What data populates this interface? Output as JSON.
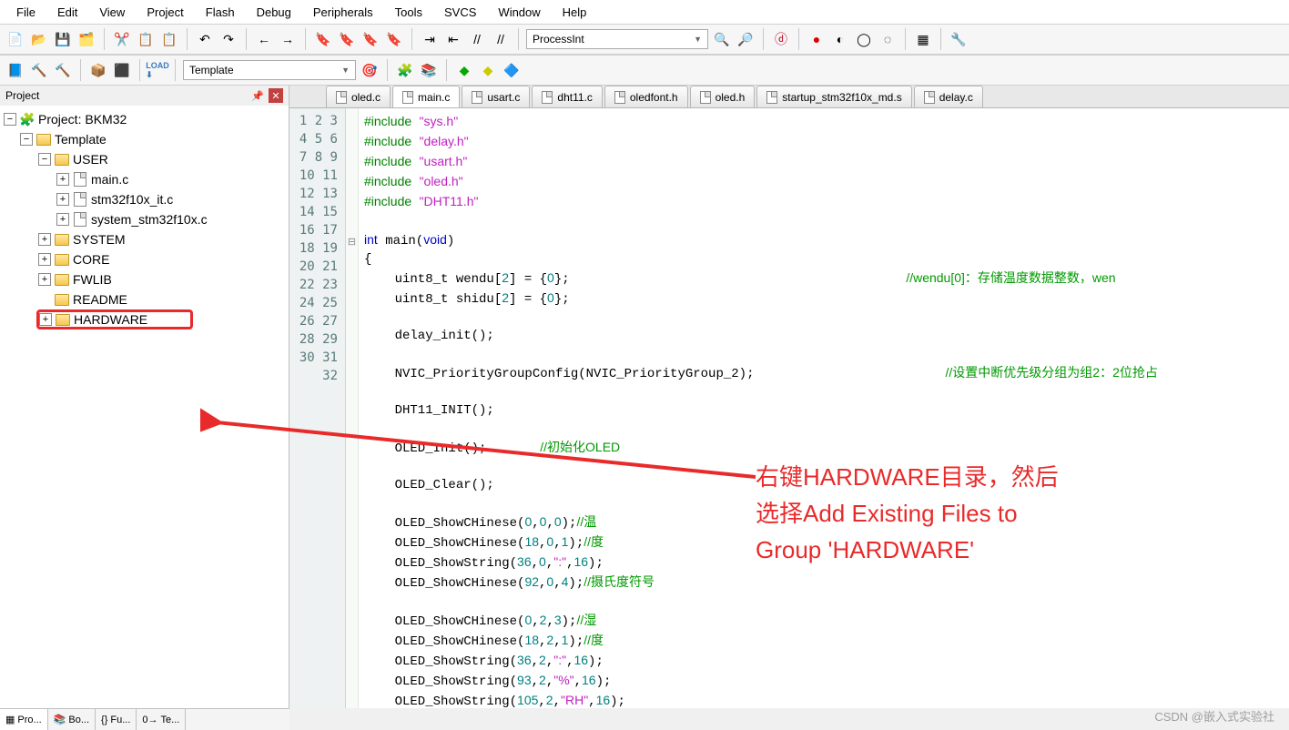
{
  "menu": [
    "File",
    "Edit",
    "View",
    "Project",
    "Flash",
    "Debug",
    "Peripherals",
    "Tools",
    "SVCS",
    "Window",
    "Help"
  ],
  "toolbar2": {
    "template_label": "Template"
  },
  "target_name": "ProcessInt",
  "project_panel": {
    "title": "Project",
    "root": "Project: BKM32",
    "target": "Template",
    "groups": {
      "user": "USER",
      "user_files": [
        "main.c",
        "stm32f10x_it.c",
        "system_stm32f10x.c"
      ],
      "system": "SYSTEM",
      "core": "CORE",
      "fwlib": "FWLIB",
      "readme": "README",
      "hardware": "HARDWARE"
    },
    "tabs": [
      "Pro...",
      "Bo...",
      "Fu...",
      "Te..."
    ]
  },
  "file_tabs": [
    "oled.c",
    "main.c",
    "usart.c",
    "dht11.c",
    "oledfont.h",
    "oled.h",
    "startup_stm32f10x_md.s",
    "delay.c"
  ],
  "active_tab": 1,
  "code_lines": [
    {
      "n": 1,
      "html": "<span class='inc'>#include</span> <span class='str'>\"sys.h\"</span>"
    },
    {
      "n": 2,
      "html": "<span class='inc'>#include</span> <span class='str'>\"delay.h\"</span>"
    },
    {
      "n": 3,
      "html": "<span class='inc'>#include</span> <span class='str'>\"usart.h\"</span>"
    },
    {
      "n": 4,
      "html": "<span class='inc'>#include</span> <span class='str'>\"oled.h\"</span>"
    },
    {
      "n": 5,
      "html": "<span class='inc'>#include</span> <span class='str'>\"DHT11.h\"</span>"
    },
    {
      "n": 6,
      "html": ""
    },
    {
      "n": 7,
      "html": "<span class='kw'>int</span> main(<span class='kw'>void</span>)"
    },
    {
      "n": 8,
      "html": "{",
      "fold": "-"
    },
    {
      "n": 9,
      "html": "    uint8_t wendu[<span class='num'>2</span>] = {<span class='num'>0</span>};                                            <span class='cmt'>//wendu[0]：存储温度数据整数，wen</span>"
    },
    {
      "n": 10,
      "html": "    uint8_t shidu[<span class='num'>2</span>] = {<span class='num'>0</span>};"
    },
    {
      "n": 11,
      "html": ""
    },
    {
      "n": 12,
      "html": "    delay_init();"
    },
    {
      "n": 13,
      "html": ""
    },
    {
      "n": 14,
      "html": "    NVIC_PriorityGroupConfig(NVIC_PriorityGroup_2);                         <span class='cmt'>//设置中断优先级分组为组2：2位抢占</span>"
    },
    {
      "n": 15,
      "html": ""
    },
    {
      "n": 16,
      "html": "    DHT11_INIT();"
    },
    {
      "n": 17,
      "html": ""
    },
    {
      "n": 18,
      "html": "    OLED_Init();       <span class='cmt'>//初始化OLED</span>"
    },
    {
      "n": 19,
      "html": ""
    },
    {
      "n": 20,
      "html": "    OLED_Clear();"
    },
    {
      "n": 21,
      "html": ""
    },
    {
      "n": 22,
      "html": "    OLED_ShowCHinese(<span class='num'>0</span>,<span class='num'>0</span>,<span class='num'>0</span>);<span class='cmt'>//温</span>"
    },
    {
      "n": 23,
      "html": "    OLED_ShowCHinese(<span class='num'>18</span>,<span class='num'>0</span>,<span class='num'>1</span>);<span class='cmt'>//度</span>"
    },
    {
      "n": 24,
      "html": "    OLED_ShowString(<span class='num'>36</span>,<span class='num'>0</span>,<span class='str'>\":\"</span>,<span class='num'>16</span>);"
    },
    {
      "n": 25,
      "html": "    OLED_ShowCHinese(<span class='num'>92</span>,<span class='num'>0</span>,<span class='num'>4</span>);<span class='cmt'>//摄氏度符号</span>"
    },
    {
      "n": 26,
      "html": ""
    },
    {
      "n": 27,
      "html": "    OLED_ShowCHinese(<span class='num'>0</span>,<span class='num'>2</span>,<span class='num'>3</span>);<span class='cmt'>//湿</span>"
    },
    {
      "n": 28,
      "html": "    OLED_ShowCHinese(<span class='num'>18</span>,<span class='num'>2</span>,<span class='num'>1</span>);<span class='cmt'>//度</span>"
    },
    {
      "n": 29,
      "html": "    OLED_ShowString(<span class='num'>36</span>,<span class='num'>2</span>,<span class='str'>\":\"</span>,<span class='num'>16</span>);"
    },
    {
      "n": 30,
      "html": "    OLED_ShowString(<span class='num'>93</span>,<span class='num'>2</span>,<span class='str'>\"%\"</span>,<span class='num'>16</span>);"
    },
    {
      "n": 31,
      "html": "    OLED_ShowString(<span class='num'>105</span>,<span class='num'>2</span>,<span class='str'>\"RH\"</span>,<span class='num'>16</span>);"
    },
    {
      "n": 32,
      "html": ""
    }
  ],
  "annotation": {
    "line1": "右键HARDWARE目录，然后",
    "line2": "选择Add Existing Files to",
    "line3": "Group 'HARDWARE'"
  },
  "watermark": "CSDN @嵌入式实验社"
}
